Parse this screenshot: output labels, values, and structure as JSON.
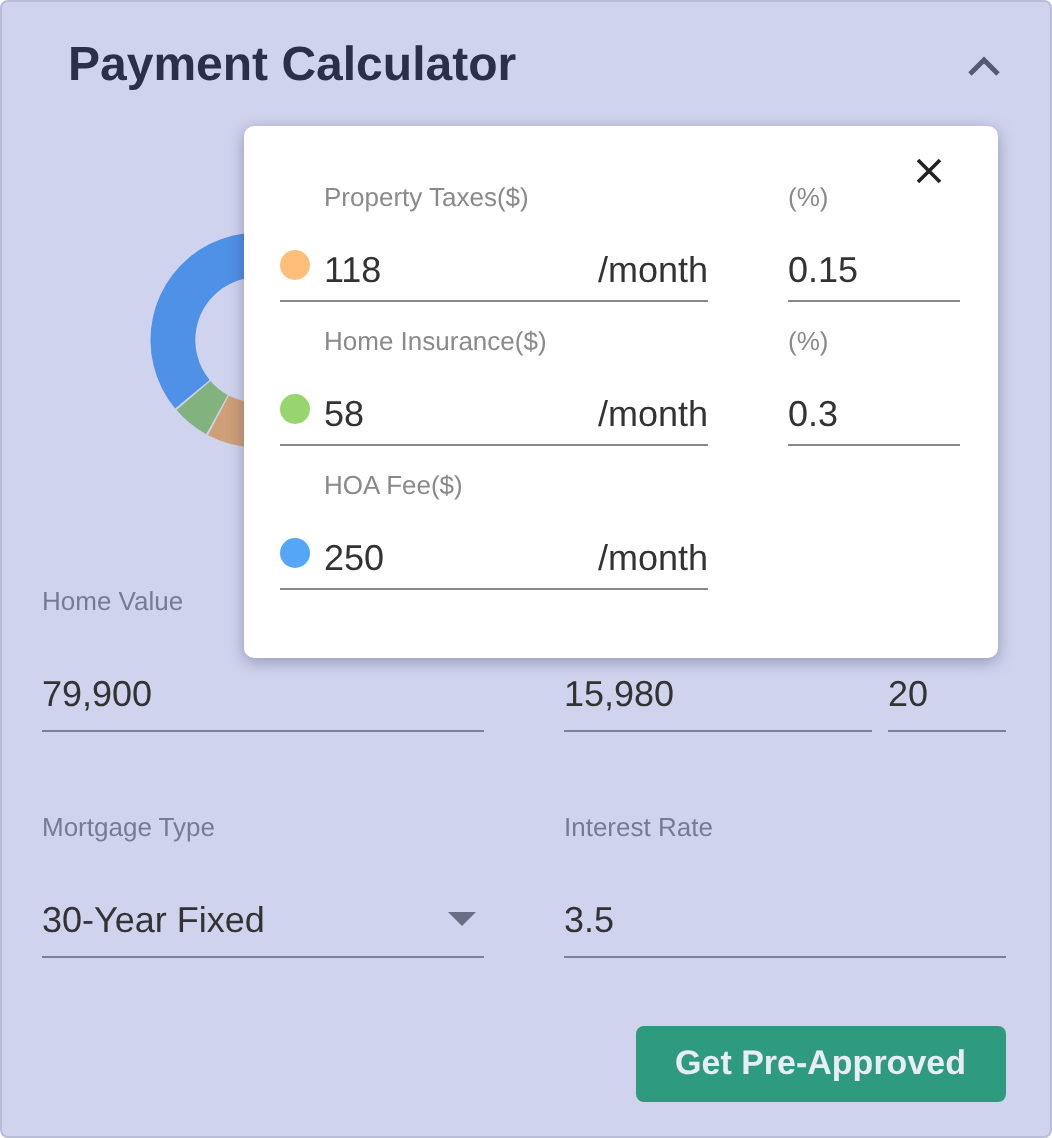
{
  "header": {
    "title": "Payment Calculator",
    "expanded": true
  },
  "fees_popup": {
    "fees": [
      {
        "label": "Property Taxes($)",
        "value": "118",
        "unit": "/month",
        "color": "#ffbf7a",
        "percent_label": "(%)",
        "percent": "0.15"
      },
      {
        "label": "Home Insurance($)",
        "value": "58",
        "unit": "/month",
        "color": "#98d56f",
        "percent_label": "(%)",
        "percent": "0.3"
      },
      {
        "label": "HOA Fee($)",
        "value": "250",
        "unit": "/month",
        "color": "#56a6f7"
      }
    ]
  },
  "home_value": {
    "label": "Home Value",
    "value": "79,900"
  },
  "down_payment": {
    "value": "15,980"
  },
  "down_payment_percent": {
    "value": "20"
  },
  "mortgage_type": {
    "label": "Mortgage Type",
    "value": "30-Year Fixed"
  },
  "interest_rate": {
    "label": "Interest Rate",
    "value": "3.5"
  },
  "button": "Get Pre-Approved"
}
